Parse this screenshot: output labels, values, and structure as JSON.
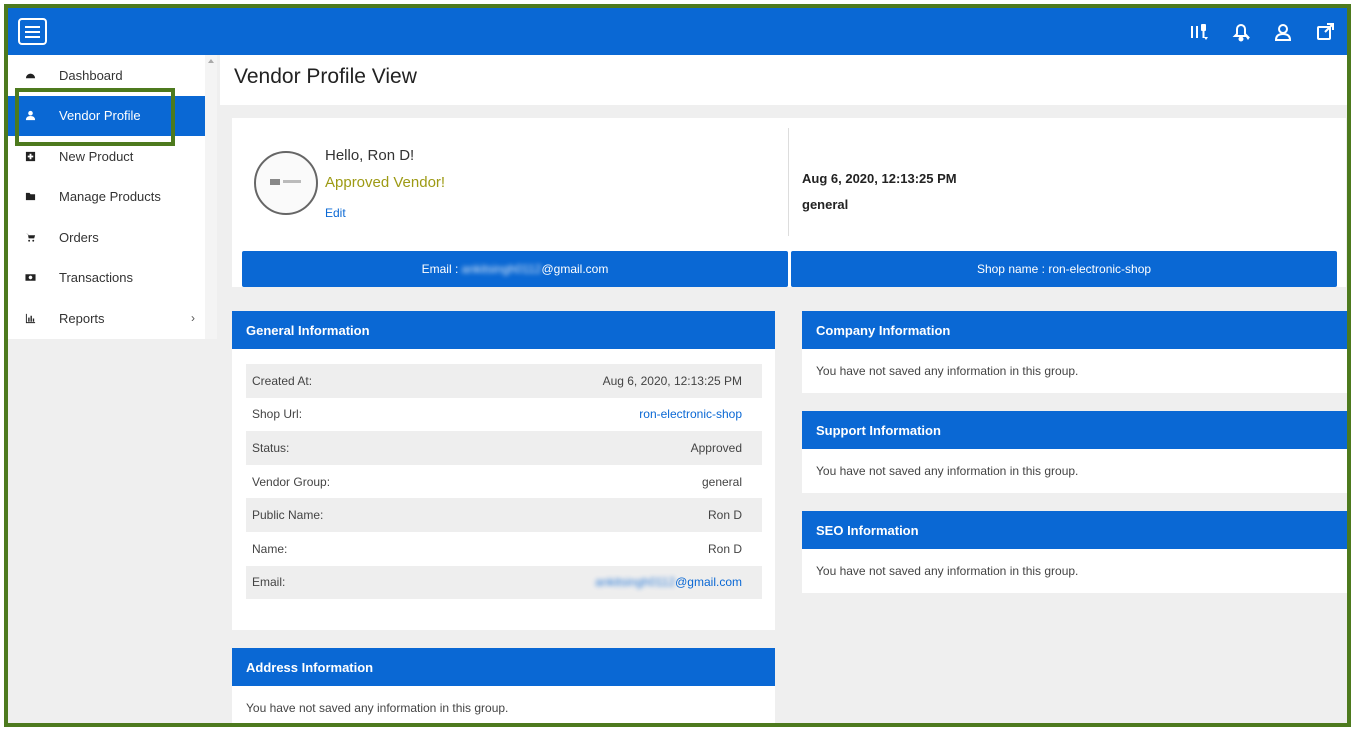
{
  "header": {
    "menu_icon": "hamburger-icon",
    "icons": [
      "settings-icon",
      "notifications-icon",
      "user-icon",
      "external-link-icon"
    ]
  },
  "sidebar": {
    "items": [
      {
        "label": "Dashboard",
        "icon": "dashboard-icon"
      },
      {
        "label": "Vendor Profile",
        "icon": "user-icon",
        "active": true
      },
      {
        "label": "New Product",
        "icon": "plus-square-icon"
      },
      {
        "label": "Manage Products",
        "icon": "folder-icon"
      },
      {
        "label": "Orders",
        "icon": "cart-icon"
      },
      {
        "label": "Transactions",
        "icon": "money-icon"
      },
      {
        "label": "Reports",
        "icon": "bar-chart-icon",
        "has_submenu": true,
        "chevron": "›"
      }
    ]
  },
  "page": {
    "title": "Vendor Profile View"
  },
  "profile": {
    "greeting": "Hello, Ron D!",
    "status": "Approved Vendor!",
    "edit_label": "Edit",
    "date": "Aug 6, 2020, 12:13:25 PM",
    "group": "general",
    "email_prefix": "Email : ",
    "email_blurred": "ankitsingh0112",
    "email_domain": "@gmail.com",
    "shop_name": "Shop name : ron-electronic-shop"
  },
  "general_info": {
    "title": "General Information",
    "rows": [
      {
        "label": "Created At:",
        "value": "Aug 6, 2020, 12:13:25 PM"
      },
      {
        "label": "Shop Url:",
        "value": "ron-electronic-shop"
      },
      {
        "label": "Status:",
        "value": "Approved"
      },
      {
        "label": "Vendor Group:",
        "value": "general"
      },
      {
        "label": "Public Name:",
        "value": "Ron D"
      },
      {
        "label": "Name:",
        "value": "Ron D"
      },
      {
        "label": "Email:",
        "value_blurred": "ankitsingh0112",
        "value_domain": "@gmail.com"
      }
    ]
  },
  "address_info": {
    "title": "Address Information",
    "message": "You have not saved any information in this group."
  },
  "company_info": {
    "title": "Company Information",
    "message": "You have not saved any information in this group."
  },
  "support_info": {
    "title": "Support Information",
    "message": "You have not saved any information in this group."
  },
  "seo_info": {
    "title": "SEO Information",
    "message": "You have not saved any information in this group."
  },
  "colors": {
    "primary": "#0a68d4",
    "approved": "#9d9a14",
    "frame_border": "#4d7a1e"
  }
}
